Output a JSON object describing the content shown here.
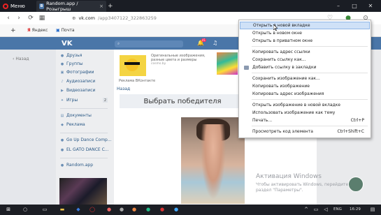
{
  "browser": {
    "menu_label": "Меню",
    "tabs": [
      {
        "title": "Random.app / Розыгрыш",
        "close": "×"
      },
      {
        "title": "+"
      }
    ],
    "address": {
      "domain": "vk.com",
      "path": "/app3407122_322863259"
    },
    "bookmarks": [
      {
        "label": "Яндекс"
      },
      {
        "label": "Почта"
      }
    ]
  },
  "vk": {
    "logo": "VK",
    "notifications_count": "41",
    "back_label": "Назад",
    "sidebar": [
      {
        "label": "Друзья",
        "icon": "friends-icon"
      },
      {
        "label": "Группы",
        "icon": "groups-icon"
      },
      {
        "label": "Фотографии",
        "icon": "photos-icon"
      },
      {
        "label": "Аудиозаписи",
        "icon": "audio-icon"
      },
      {
        "label": "Видеозаписи",
        "icon": "video-icon"
      },
      {
        "label": "Игры",
        "icon": "games-icon",
        "badge": "2"
      },
      {
        "label": "Документы",
        "icon": "documents-icon"
      },
      {
        "label": "Реклама",
        "icon": "ads-icon"
      },
      {
        "label": "Go Up Dance Comp...",
        "icon": "group-icon"
      },
      {
        "label": "EL GATO DANCE C...",
        "icon": "group-icon"
      },
      {
        "label": "Random.app",
        "icon": "app-icon"
      }
    ],
    "ad": {
      "text": "Оригинальные изображения, разные цвета и размеры",
      "domain": "cosms.by",
      "label": "Реклама ВКонтакте"
    },
    "nav_back": "Назад",
    "choose_winner": "Выбрать победителя"
  },
  "context_menu": {
    "items": [
      {
        "label": "Открыть в новой вкладке",
        "highlighted": true
      },
      {
        "label": "Открыть в новом окне"
      },
      {
        "label": "Открыть в приватном окне"
      },
      {
        "sep": true
      },
      {
        "label": "Копировать адрес ссылки"
      },
      {
        "label": "Сохранить ссылку как..."
      },
      {
        "label": "Добавить ссылку в закладки",
        "icon": "heart-icon"
      },
      {
        "sep": true
      },
      {
        "label": "Сохранить изображение как..."
      },
      {
        "label": "Копировать изображение"
      },
      {
        "label": "Копировать адрес изображения"
      },
      {
        "sep": true
      },
      {
        "label": "Открыть изображение в новой вкладке"
      },
      {
        "label": "Использовать изображение как тему"
      },
      {
        "label": "Печать...",
        "shortcut": "Ctrl+P"
      },
      {
        "sep": true
      },
      {
        "label": "Просмотреть код элемента",
        "shortcut": "Ctrl+Shift+C"
      }
    ]
  },
  "watermark": {
    "title": "Активация Windows",
    "text": "Чтобы активировать Windows, перейдите в раздел \"Параметры\"."
  },
  "taskbar": {
    "lang": "ENG",
    "time": "16:29"
  }
}
